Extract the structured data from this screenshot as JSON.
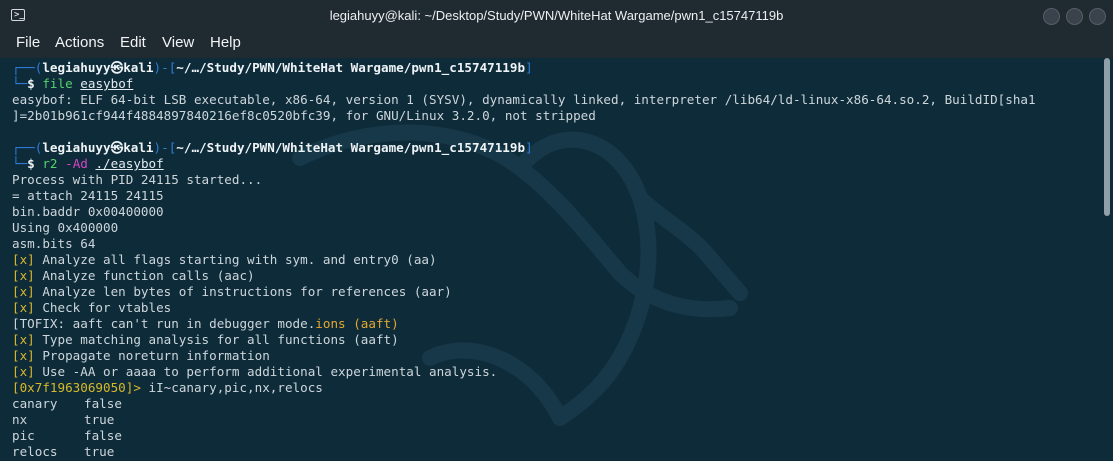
{
  "window": {
    "title": "legiahuyy@kali: ~/Desktop/Study/PWN/WhiteHat Wargame/pwn1_c15747119b"
  },
  "menu": [
    "File",
    "Actions",
    "Edit",
    "View",
    "Help"
  ],
  "prompt": {
    "user": "legiahuyy",
    "at": "㉿",
    "host": "kali",
    "path": "~/…/Study/PWN/WhiteHat Wargame/pwn1_c15747119b",
    "top_prefix": "┌──(",
    "close": ")-[",
    "end": "]",
    "bottom_prefix": "└─",
    "dollar": "$ "
  },
  "cmd1": {
    "name": "file",
    "arg": "easybof"
  },
  "file_output": [
    "easybof: ELF 64-bit LSB executable, x86-64, version 1 (SYSV), dynamically linked, interpreter /lib64/ld-linux-x86-64.so.2, BuildID[sha1",
    "]=2b01b961cf944f4884897840216ef8c0520bfc39, for GNU/Linux 3.2.0, not stripped"
  ],
  "cmd2": {
    "name": "r2",
    "flag": "-Ad",
    "arg": "./easybof"
  },
  "r2_output": [
    "Process with PID 24115 started...",
    "= attach 24115 24115",
    "bin.baddr 0x00400000",
    "Using 0x400000",
    "asm.bits 64"
  ],
  "analysis": [
    {
      "mark": "[x]",
      "text": " Analyze all flags starting with sym. and entry0 (aa)"
    },
    {
      "mark": "[x]",
      "text": " Analyze function calls (aac)"
    },
    {
      "mark": "[x]",
      "text": " Analyze len bytes of instructions for references (aar)"
    },
    {
      "mark": "[x]",
      "text": " Check for vtables"
    }
  ],
  "tofix": {
    "text": "[TOFIX: aaft can't run in debugger mode.",
    "tail": "ions (aaft)"
  },
  "analysis2": [
    {
      "mark": "[x]",
      "text": " Type matching analysis for all functions (aaft)"
    },
    {
      "mark": "[x]",
      "text": " Propagate noreturn information"
    },
    {
      "mark": "[x]",
      "text": " Use -AA or aaaa to perform additional experimental analysis."
    }
  ],
  "r2_prompt": {
    "addr": "[0x7f1963069050]>",
    "cmd": " iI~canary,pic,nx,relocs"
  },
  "info_rows": [
    {
      "key": "canary",
      "value": "false"
    },
    {
      "key": "nx",
      "value": "true"
    },
    {
      "key": "pic",
      "value": "false"
    },
    {
      "key": "relocs",
      "value": "true"
    }
  ],
  "colors": {
    "prompt_blue": "#2f7cd8",
    "green": "#55d36b",
    "magenta": "#d146c6",
    "yellow": "#d8b92a"
  }
}
